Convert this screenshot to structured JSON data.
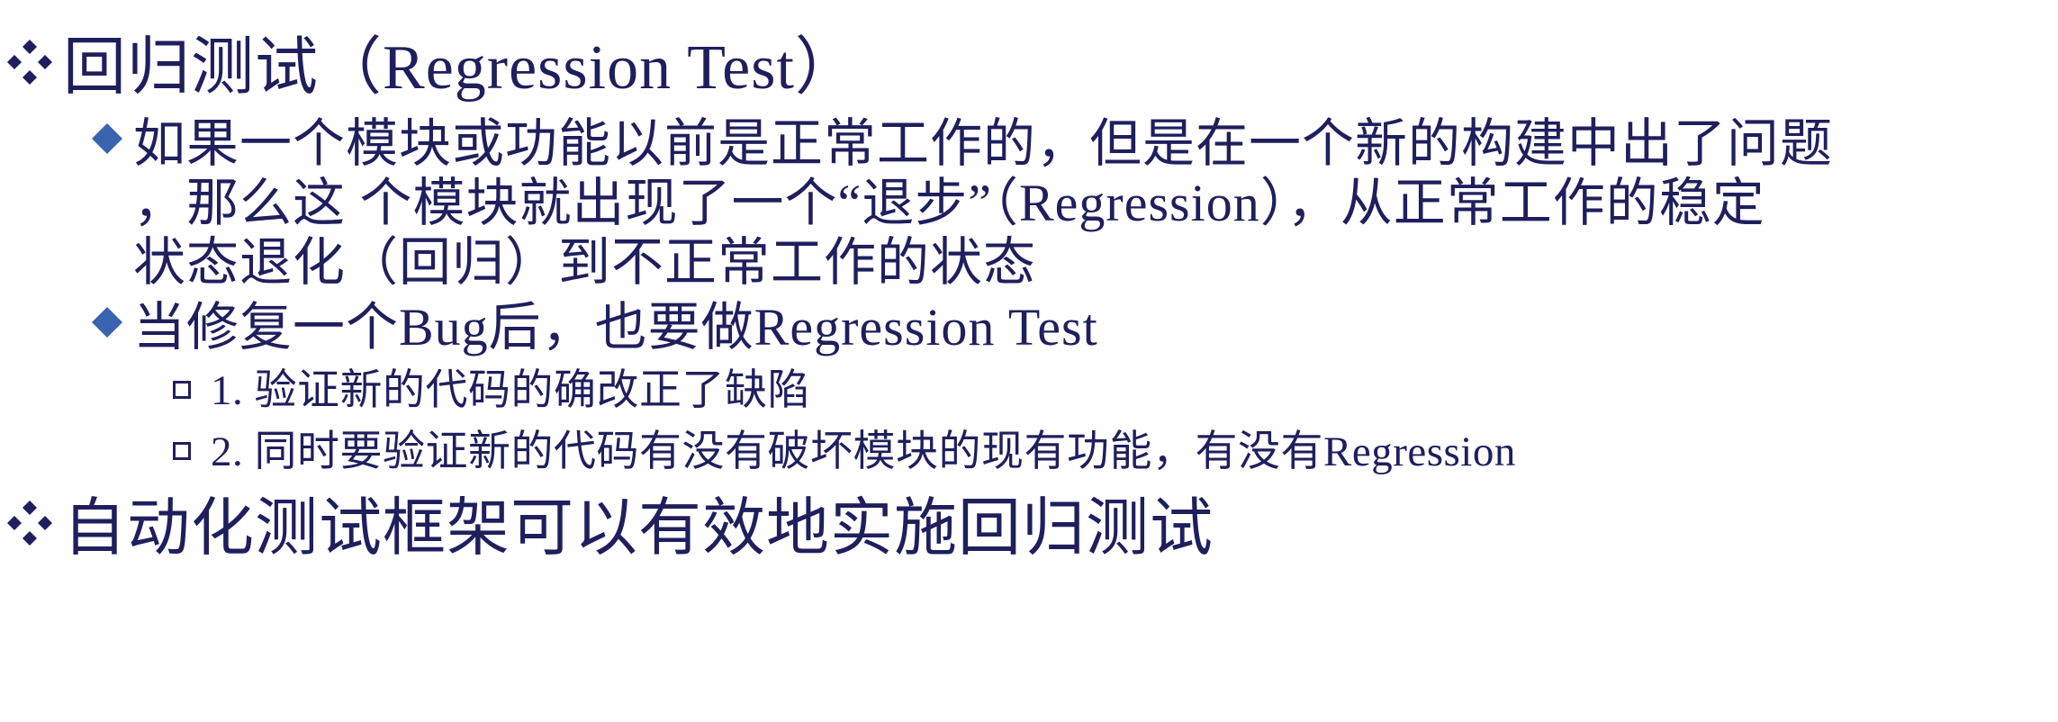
{
  "slide": {
    "items": [
      {
        "level": 1,
        "bullet_icon": "four-diamond-icon",
        "text": "回归测试（Regression Test）"
      },
      {
        "level": 2,
        "bullet_icon": "diamond-icon",
        "lines": [
          "如果一个模块或功能以前是正常工作的，但是在一个新的构建中出了问题",
          "，那么这 个模块就出现了一个“退步”（Regression），从正常工作的稳定",
          "状态退化（回归）到不正常工作的状态"
        ]
      },
      {
        "level": 2,
        "bullet_icon": "diamond-icon",
        "text": "当修复一个Bug后，也要做Regression Test"
      },
      {
        "level": 3,
        "bullet_icon": "square-outline-icon",
        "text": "1. 验证新的代码的确改正了缺陷"
      },
      {
        "level": 3,
        "bullet_icon": "square-outline-icon",
        "text": "2. 同时要验证新的代码有没有破坏模块的现有功能，有没有Regression"
      },
      {
        "level": 1,
        "bullet_icon": "four-diamond-icon",
        "text": "自动化测试框架可以有效地实施回归测试"
      }
    ]
  },
  "colors": {
    "text": "#1f1f5e",
    "level1_bullet": "#1f1f5e",
    "level2_bullet": "#3a63b0",
    "level3_bullet": "#1f1f5e",
    "background": "#ffffff"
  }
}
